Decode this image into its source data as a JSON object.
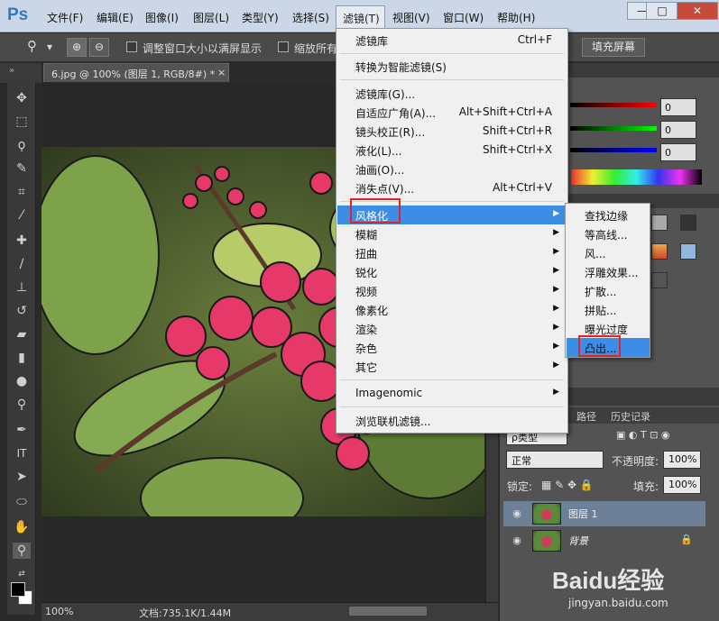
{
  "app": {
    "logo": "Ps"
  },
  "menubar": {
    "items": [
      "文件(F)",
      "编辑(E)",
      "图像(I)",
      "图层(L)",
      "类型(Y)",
      "选择(S)",
      "滤镜(T)",
      "视图(V)",
      "窗口(W)",
      "帮助(H)"
    ]
  },
  "window_controls": {
    "minimize": "—",
    "restore": "□",
    "close": "✕"
  },
  "options_bar": {
    "resize_windows_label": "调整窗口大小以满屏显示",
    "zoom_all_label": "缩放所有",
    "fill_screen_button": "填充屏幕"
  },
  "document": {
    "tab_title": "6.jpg @ 100% (图层 1, RGB/8#) *",
    "tab_close": "×",
    "zoom": "100%",
    "doc_size": "文档:735.1K/1.44M"
  },
  "filter_menu": {
    "items": [
      {
        "label": "滤镜库",
        "shortcut": "Ctrl+F"
      },
      {
        "label": "转换为智能滤镜(S)",
        "shortcut": ""
      },
      {
        "label": "滤镜库(G)...",
        "shortcut": ""
      },
      {
        "label": "自适应广角(A)...",
        "shortcut": "Alt+Shift+Ctrl+A"
      },
      {
        "label": "镜头校正(R)...",
        "shortcut": "Shift+Ctrl+R"
      },
      {
        "label": "液化(L)...",
        "shortcut": "Shift+Ctrl+X"
      },
      {
        "label": "油画(O)...",
        "shortcut": ""
      },
      {
        "label": "消失点(V)...",
        "shortcut": "Alt+Ctrl+V"
      },
      {
        "label": "风格化",
        "shortcut": ""
      },
      {
        "label": "模糊",
        "shortcut": ""
      },
      {
        "label": "扭曲",
        "shortcut": ""
      },
      {
        "label": "锐化",
        "shortcut": ""
      },
      {
        "label": "视频",
        "shortcut": ""
      },
      {
        "label": "像素化",
        "shortcut": ""
      },
      {
        "label": "渲染",
        "shortcut": ""
      },
      {
        "label": "杂色",
        "shortcut": ""
      },
      {
        "label": "其它",
        "shortcut": ""
      },
      {
        "label": "Imagenomic",
        "shortcut": ""
      },
      {
        "label": "浏览联机滤镜...",
        "shortcut": ""
      }
    ],
    "highlighted": "风格化"
  },
  "stylize_submenu": {
    "items": [
      "查找边缘",
      "等高线...",
      "风...",
      "浮雕效果...",
      "扩散...",
      "拼贴...",
      "曝光过度",
      "凸出..."
    ],
    "highlighted": "凸出..."
  },
  "color_panel": {
    "r": "0",
    "g": "0",
    "b": "0"
  },
  "layers_panel": {
    "tabs": [
      "路径",
      "历史记录"
    ],
    "filter_kind": "ρ类型",
    "blend_mode": "正常",
    "opacity_label": "不透明度:",
    "opacity_value": "100%",
    "lock_label": "锁定:",
    "fill_label": "填充:",
    "fill_value": "100%",
    "layers": [
      {
        "name": "图层 1",
        "selected": true
      },
      {
        "name": "背景",
        "selected": false,
        "locked": true
      }
    ]
  },
  "watermark": {
    "brand": "Baidu经验",
    "url": "jingyan.baidu.com"
  },
  "colors": {
    "highlight": "#3b8de6",
    "red_box": "#e02424",
    "menubar": "#cbd7e6"
  }
}
